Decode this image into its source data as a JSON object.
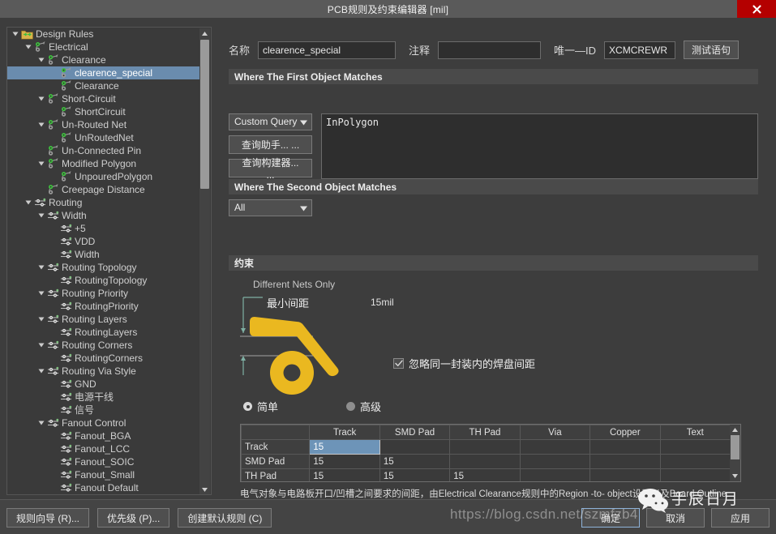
{
  "window": {
    "title": "PCB规则及约束编辑器 [mil]",
    "close_icon": "close-icon"
  },
  "tree": {
    "items": [
      {
        "label": "Design Rules",
        "depth": 0,
        "icon": "folder-rules-icon",
        "expander": "expanded",
        "selected": false
      },
      {
        "label": "Electrical",
        "depth": 1,
        "icon": "rule-electrical-icon",
        "expander": "expanded",
        "selected": false
      },
      {
        "label": "Clearance",
        "depth": 2,
        "icon": "rule-electrical-icon",
        "expander": "expanded",
        "selected": false
      },
      {
        "label": "clearence_special",
        "depth": 3,
        "icon": "rule-electrical-icon",
        "expander": "none",
        "selected": true
      },
      {
        "label": "Clearance",
        "depth": 3,
        "icon": "rule-electrical-icon",
        "expander": "none",
        "selected": false
      },
      {
        "label": "Short-Circuit",
        "depth": 2,
        "icon": "rule-electrical-icon",
        "expander": "expanded",
        "selected": false
      },
      {
        "label": "ShortCircuit",
        "depth": 3,
        "icon": "rule-electrical-icon",
        "expander": "none",
        "selected": false
      },
      {
        "label": "Un-Routed Net",
        "depth": 2,
        "icon": "rule-electrical-icon",
        "expander": "expanded",
        "selected": false
      },
      {
        "label": "UnRoutedNet",
        "depth": 3,
        "icon": "rule-electrical-icon",
        "expander": "none",
        "selected": false
      },
      {
        "label": "Un-Connected Pin",
        "depth": 2,
        "icon": "rule-electrical-icon",
        "expander": "none",
        "selected": false
      },
      {
        "label": "Modified Polygon",
        "depth": 2,
        "icon": "rule-electrical-icon",
        "expander": "expanded",
        "selected": false
      },
      {
        "label": "UnpouredPolygon",
        "depth": 3,
        "icon": "rule-electrical-icon",
        "expander": "none",
        "selected": false
      },
      {
        "label": "Creepage Distance",
        "depth": 2,
        "icon": "rule-electrical-icon",
        "expander": "none",
        "selected": false
      },
      {
        "label": "Routing",
        "depth": 1,
        "icon": "rule-routing-icon",
        "expander": "expanded",
        "selected": false
      },
      {
        "label": "Width",
        "depth": 2,
        "icon": "rule-routing-icon",
        "expander": "expanded",
        "selected": false
      },
      {
        "label": "+5",
        "depth": 3,
        "icon": "rule-routing-icon",
        "expander": "none",
        "selected": false
      },
      {
        "label": "VDD",
        "depth": 3,
        "icon": "rule-routing-icon",
        "expander": "none",
        "selected": false
      },
      {
        "label": "Width",
        "depth": 3,
        "icon": "rule-routing-icon",
        "expander": "none",
        "selected": false
      },
      {
        "label": "Routing Topology",
        "depth": 2,
        "icon": "rule-routing-icon",
        "expander": "expanded",
        "selected": false
      },
      {
        "label": "RoutingTopology",
        "depth": 3,
        "icon": "rule-routing-icon",
        "expander": "none",
        "selected": false
      },
      {
        "label": "Routing Priority",
        "depth": 2,
        "icon": "rule-routing-icon",
        "expander": "expanded",
        "selected": false
      },
      {
        "label": "RoutingPriority",
        "depth": 3,
        "icon": "rule-routing-icon",
        "expander": "none",
        "selected": false
      },
      {
        "label": "Routing Layers",
        "depth": 2,
        "icon": "rule-routing-icon",
        "expander": "expanded",
        "selected": false
      },
      {
        "label": "RoutingLayers",
        "depth": 3,
        "icon": "rule-routing-icon",
        "expander": "none",
        "selected": false
      },
      {
        "label": "Routing Corners",
        "depth": 2,
        "icon": "rule-routing-icon",
        "expander": "expanded",
        "selected": false
      },
      {
        "label": "RoutingCorners",
        "depth": 3,
        "icon": "rule-routing-icon",
        "expander": "none",
        "selected": false
      },
      {
        "label": "Routing Via Style",
        "depth": 2,
        "icon": "rule-routing-icon",
        "expander": "expanded",
        "selected": false
      },
      {
        "label": "GND",
        "depth": 3,
        "icon": "rule-routing-icon",
        "expander": "none",
        "selected": false
      },
      {
        "label": "电源干线",
        "depth": 3,
        "icon": "rule-routing-icon",
        "expander": "none",
        "selected": false
      },
      {
        "label": "信号",
        "depth": 3,
        "icon": "rule-routing-icon",
        "expander": "none",
        "selected": false
      },
      {
        "label": "Fanout Control",
        "depth": 2,
        "icon": "rule-routing-icon",
        "expander": "expanded",
        "selected": false
      },
      {
        "label": "Fanout_BGA",
        "depth": 3,
        "icon": "rule-routing-icon",
        "expander": "none",
        "selected": false
      },
      {
        "label": "Fanout_LCC",
        "depth": 3,
        "icon": "rule-routing-icon",
        "expander": "none",
        "selected": false
      },
      {
        "label": "Fanout_SOIC",
        "depth": 3,
        "icon": "rule-routing-icon",
        "expander": "none",
        "selected": false
      },
      {
        "label": "Fanout_Small",
        "depth": 3,
        "icon": "rule-routing-icon",
        "expander": "none",
        "selected": false
      },
      {
        "label": "Fanout Default",
        "depth": 3,
        "icon": "rule-routing-icon",
        "expander": "none",
        "selected": false
      }
    ]
  },
  "header": {
    "name_label": "名称",
    "name_value": "clearence_special",
    "comment_label": "注释",
    "comment_value": "",
    "unique_id_label": "唯一—ID",
    "unique_id_value": "XCMCREWR",
    "test_query_button": "测试语句"
  },
  "first_object": {
    "section_title": "Where The First Object Matches",
    "scope_value": "Custom Query",
    "query_helper_button": "查询助手... ...",
    "query_builder_button": "查询构建器... ...",
    "query_text": "InPolygon"
  },
  "second_object": {
    "section_title": "Where The Second Object Matches",
    "scope_value": "All"
  },
  "constraint": {
    "section_title": "约束",
    "different_nets_only": "Different Nets Only",
    "min_clearance_label": "最小间距",
    "min_clearance_value": "15mil",
    "ignore_pad_checkbox_label": "忽略同一封装内的焊盘间距",
    "ignore_pad_checked": true,
    "mode_simple": "简单",
    "mode_advanced": "高级",
    "mode_selected": "简单",
    "accent_color": "#eab820",
    "description": "电气对象与电路板开口/凹槽之间要求的间距，由Electrical Clearance规则中的Region -to- object设置以及Board Outline Clearance规则设置中的最大值决定."
  },
  "matrix": {
    "columns": [
      "",
      "Track",
      "SMD Pad",
      "TH Pad",
      "Via",
      "Copper",
      "Text"
    ],
    "rows": [
      {
        "label": "Track",
        "values": [
          "15",
          "",
          "",
          "",
          "",
          ""
        ],
        "selected_index": 0
      },
      {
        "label": "SMD Pad",
        "values": [
          "15",
          "15",
          "",
          "",
          "",
          ""
        ],
        "selected_index": -1
      },
      {
        "label": "TH Pad",
        "values": [
          "15",
          "15",
          "15",
          "",
          "",
          ""
        ],
        "selected_index": -1
      }
    ]
  },
  "footer": {
    "rule_wizard": "规则向导 (R)...",
    "priority": "优先级 (P)...",
    "create_default": "创建默认规则 (C)",
    "ok": "确定",
    "cancel": "取消",
    "apply": "应用"
  },
  "watermark": {
    "brand": "手辰日月",
    "url": "https://blog.csdn.net/szmfzb4"
  }
}
